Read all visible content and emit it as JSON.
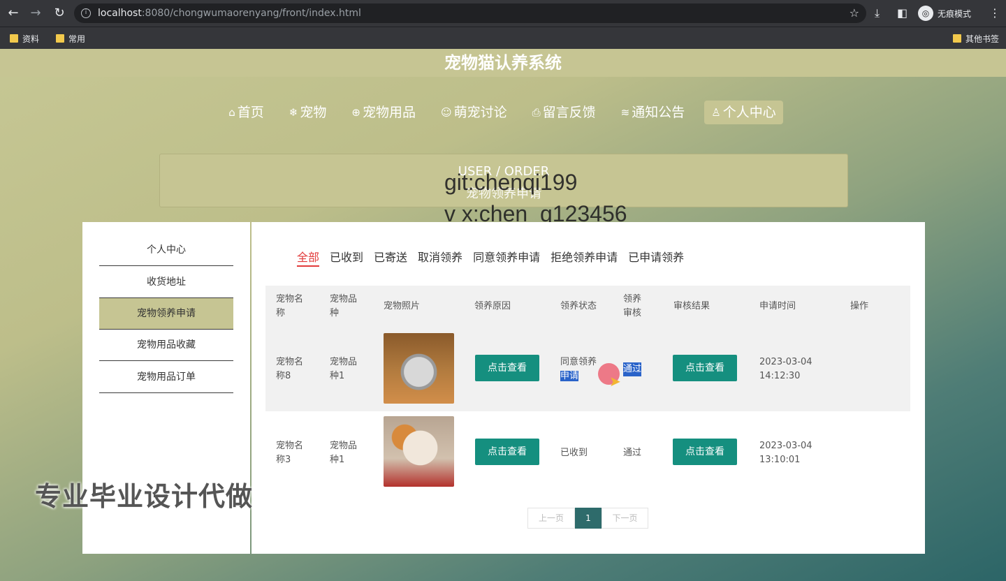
{
  "browser": {
    "url_host": "localhost",
    "url_path": ":8080/chongwumaorenyang/front/index.html",
    "profile_label": "无痕模式",
    "bookmarks": [
      "资料",
      "常用"
    ],
    "other_bookmarks": "其他书签"
  },
  "site": {
    "title": "宠物猫认养系统",
    "nav": [
      {
        "icon": "home-icon",
        "glyph": "⌂",
        "label": "首页"
      },
      {
        "icon": "snowflake-icon",
        "glyph": "❄",
        "label": "宠物"
      },
      {
        "icon": "globe-icon",
        "glyph": "⊕",
        "label": "宠物用品"
      },
      {
        "icon": "smile-icon",
        "glyph": "☺",
        "label": "萌宠讨论"
      },
      {
        "icon": "print-icon",
        "glyph": "⎙",
        "label": "留言反馈"
      },
      {
        "icon": "layers-icon",
        "glyph": "≋",
        "label": "通知公告"
      },
      {
        "icon": "user-icon",
        "glyph": "♙",
        "label": "个人中心",
        "active": true
      }
    ]
  },
  "banner": {
    "title": "USER / ORDER",
    "subtitle": "宠物领养申请"
  },
  "overlay": {
    "line1": "git:chenqi199",
    "line2": "v x:chen_q123456",
    "promo": "专业毕业设计代做"
  },
  "sidebar": {
    "items": [
      "个人中心",
      "收货地址",
      "宠物领养申请",
      "宠物用品收藏",
      "宠物用品订单"
    ],
    "active_index": 2
  },
  "tabs": [
    "全部",
    "已收到",
    "已寄送",
    "取消领养",
    "同意领养申请",
    "拒绝领养申请",
    "已申请领养"
  ],
  "table": {
    "headers": {
      "name": "宠物名称",
      "breed": "宠物品种",
      "photo": "宠物照片",
      "reason": "领养原因",
      "status": "领养状态",
      "review": "领养审核",
      "result": "审核结果",
      "time": "申请时间",
      "action": "操作"
    },
    "rows": [
      {
        "name": "宠物名称8",
        "breed": "宠物品种1",
        "reason_button": "点击查看",
        "status_a": "同意领养",
        "status_b": "申请",
        "review": "通过",
        "result_button": "点击查看",
        "date": "2023-03-04",
        "time": "14:12:30"
      },
      {
        "name": "宠物名称3",
        "breed": "宠物品种1",
        "reason_button": "点击查看",
        "status_a": "已收到",
        "status_b": "",
        "review": "通过",
        "result_button": "点击查看",
        "date": "2023-03-04",
        "time": "13:10:01"
      }
    ]
  },
  "pager": {
    "prev": "上一页",
    "current": "1",
    "next": "下一页"
  },
  "colors": {
    "accent": "#c6c593",
    "teal": "#2e6f6d",
    "button": "#158f7f",
    "tab_active": "#e23b3b"
  }
}
